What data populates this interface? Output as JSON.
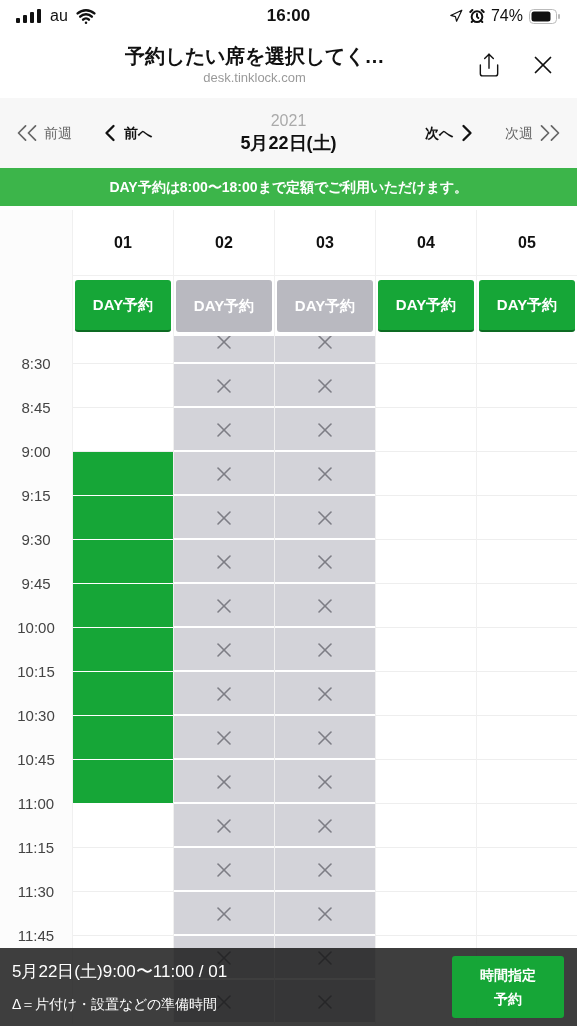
{
  "status_bar": {
    "carrier": "au",
    "time": "16:00",
    "battery": "74%"
  },
  "header": {
    "title": "予約したい席を選択してく…",
    "url": "desk.tinklock.com"
  },
  "date_nav": {
    "prev_week": "前週",
    "prev": "前へ",
    "year": "2021",
    "date": "5月22日(土)",
    "next": "次へ",
    "next_week": "次週"
  },
  "banner": "DAY予約は8:00〜18:00まで定額でご利用いただけます。",
  "times": [
    "8:30",
    "8:45",
    "9:00",
    "9:15",
    "9:30",
    "9:45",
    "10:00",
    "10:15",
    "10:30",
    "10:45",
    "11:00",
    "11:15",
    "11:30",
    "11:45"
  ],
  "columns": [
    {
      "label": "01",
      "day_button": {
        "label": "DAY予約",
        "disabled": false
      },
      "slots": [
        {
          "kind": "free"
        },
        {
          "kind": "free"
        },
        {
          "kind": "free"
        },
        {
          "kind": "selected"
        },
        {
          "kind": "selected"
        },
        {
          "kind": "selected"
        },
        {
          "kind": "selected"
        },
        {
          "kind": "selected"
        },
        {
          "kind": "selected"
        },
        {
          "kind": "selected"
        },
        {
          "kind": "selected"
        },
        {
          "kind": "free"
        },
        {
          "kind": "free"
        },
        {
          "kind": "free"
        }
      ]
    },
    {
      "label": "02",
      "day_button": {
        "label": "DAY予約",
        "disabled": true
      },
      "slots": [
        {
          "kind": "unavailable"
        },
        {
          "kind": "unavailable"
        },
        {
          "kind": "unavailable"
        },
        {
          "kind": "unavailable"
        },
        {
          "kind": "unavailable"
        },
        {
          "kind": "unavailable"
        },
        {
          "kind": "unavailable"
        },
        {
          "kind": "unavailable"
        },
        {
          "kind": "unavailable"
        },
        {
          "kind": "unavailable"
        },
        {
          "kind": "unavailable"
        },
        {
          "kind": "unavailable"
        },
        {
          "kind": "unavailable"
        },
        {
          "kind": "unavailable"
        },
        {
          "kind": "unavailable"
        },
        {
          "kind": "unavailable"
        }
      ]
    },
    {
      "label": "03",
      "day_button": {
        "label": "DAY予約",
        "disabled": true
      },
      "slots": [
        {
          "kind": "unavailable"
        },
        {
          "kind": "unavailable"
        },
        {
          "kind": "unavailable"
        },
        {
          "kind": "unavailable"
        },
        {
          "kind": "unavailable"
        },
        {
          "kind": "unavailable"
        },
        {
          "kind": "unavailable"
        },
        {
          "kind": "unavailable"
        },
        {
          "kind": "unavailable"
        },
        {
          "kind": "unavailable"
        },
        {
          "kind": "unavailable"
        },
        {
          "kind": "unavailable"
        },
        {
          "kind": "unavailable"
        },
        {
          "kind": "unavailable"
        },
        {
          "kind": "unavailable"
        },
        {
          "kind": "unavailable"
        }
      ]
    },
    {
      "label": "04",
      "day_button": {
        "label": "DAY予約",
        "disabled": false
      },
      "slots": [
        {
          "kind": "free"
        },
        {
          "kind": "free"
        },
        {
          "kind": "free"
        },
        {
          "kind": "free"
        },
        {
          "kind": "free"
        },
        {
          "kind": "free"
        },
        {
          "kind": "free"
        },
        {
          "kind": "free"
        },
        {
          "kind": "free"
        },
        {
          "kind": "free"
        },
        {
          "kind": "free"
        },
        {
          "kind": "free"
        },
        {
          "kind": "free"
        },
        {
          "kind": "free"
        }
      ]
    },
    {
      "label": "05",
      "day_button": {
        "label": "DAY予約",
        "disabled": false
      },
      "slots": [
        {
          "kind": "free"
        },
        {
          "kind": "free"
        },
        {
          "kind": "free"
        },
        {
          "kind": "free"
        },
        {
          "kind": "free"
        },
        {
          "kind": "free"
        },
        {
          "kind": "free"
        },
        {
          "kind": "free"
        },
        {
          "kind": "free"
        },
        {
          "kind": "free"
        },
        {
          "kind": "free"
        },
        {
          "kind": "free"
        },
        {
          "kind": "free"
        },
        {
          "kind": "free"
        }
      ]
    }
  ],
  "footer": {
    "selection": "5月22日(土)9:00〜11:00 / 01",
    "note": "Δ＝片付け・設置などの準備時間",
    "button": "時間指定予約"
  }
}
